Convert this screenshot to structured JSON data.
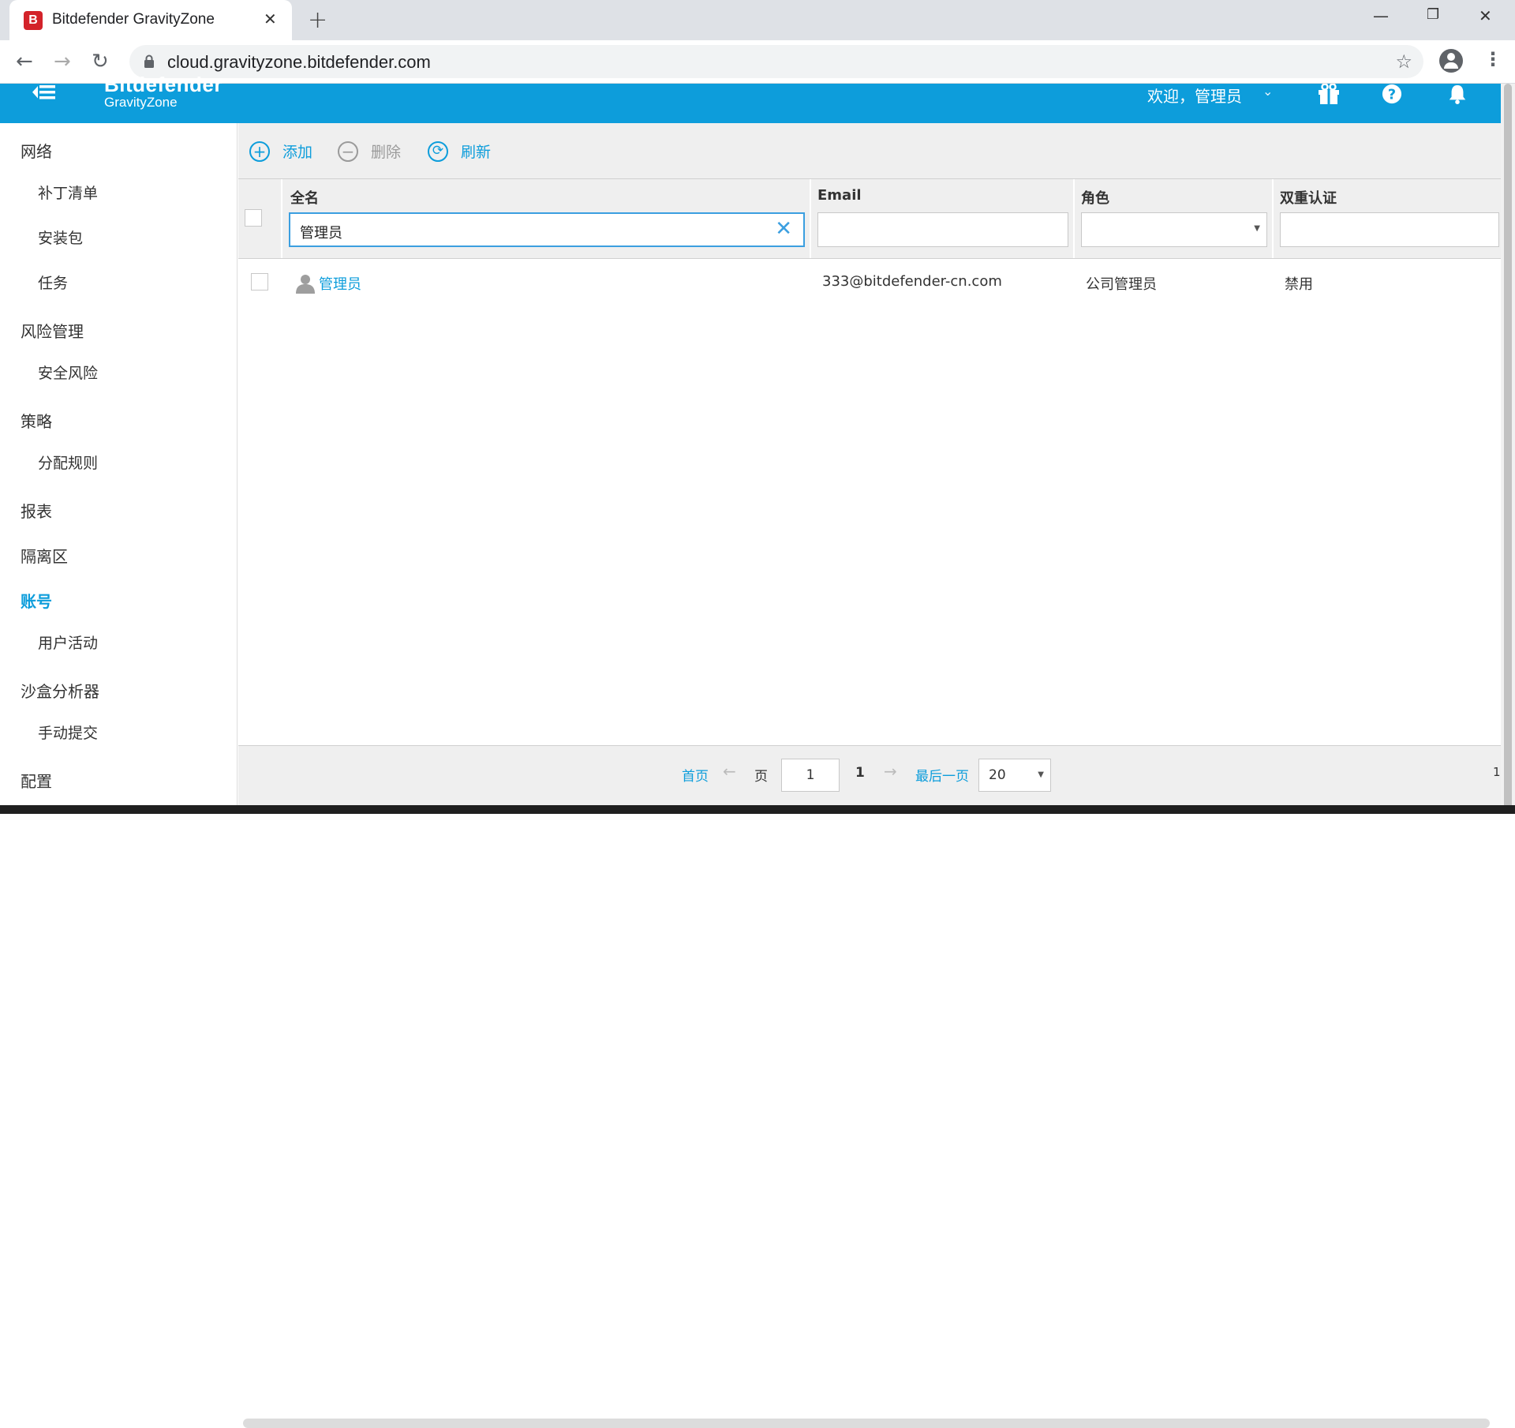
{
  "browser": {
    "tab_title": "Bitdefender GravityZone",
    "favicon_letter": "B",
    "url": "cloud.gravityzone.bitdefender.com",
    "icons": [
      "back-icon",
      "forward-icon",
      "reload-icon",
      "lock-icon",
      "star-icon",
      "profile-icon",
      "more-icon"
    ]
  },
  "header": {
    "logo_line1": "Bitdefender",
    "logo_line2": "GravityZone",
    "welcome": "欢迎，管理员",
    "icons": [
      "menu-collapse-icon",
      "gift-icon",
      "help-icon",
      "bell-icon"
    ],
    "background": "#0d9ddb"
  },
  "sidebar": {
    "items": [
      {
        "label": "网络",
        "level": "top"
      },
      {
        "label": "补丁清单",
        "level": "sub"
      },
      {
        "label": "安装包",
        "level": "sub"
      },
      {
        "label": "任务",
        "level": "sub"
      },
      {
        "label": "风险管理",
        "level": "top"
      },
      {
        "label": "安全风险",
        "level": "sub"
      },
      {
        "label": "策略",
        "level": "top"
      },
      {
        "label": "分配规则",
        "level": "sub"
      },
      {
        "label": "报表",
        "level": "top"
      },
      {
        "label": "隔离区",
        "level": "top"
      },
      {
        "label": "账号",
        "level": "top",
        "active": true
      },
      {
        "label": "用户活动",
        "level": "sub"
      },
      {
        "label": "沙盒分析器",
        "level": "top"
      },
      {
        "label": "手动提交",
        "level": "sub"
      },
      {
        "label": "配置",
        "level": "top"
      }
    ]
  },
  "toolbar": {
    "add_label": "添加",
    "delete_label": "删除",
    "refresh_label": "刷新"
  },
  "grid": {
    "columns": [
      "全名",
      "Email",
      "角色",
      "双重认证"
    ],
    "filters": {
      "fullname_value": "管理员",
      "email_value": "",
      "role_value": "",
      "twofa_value": ""
    },
    "rows": [
      {
        "fullname": "管理员",
        "email": "333@bitdefender-cn.com",
        "role": "公司管理员",
        "twofa": "禁用"
      }
    ]
  },
  "pagination": {
    "first": "首页",
    "page_label": "页",
    "current_page": "1",
    "total_pages": "1",
    "last": "最后一页",
    "page_size": "20",
    "count_right": "1"
  }
}
